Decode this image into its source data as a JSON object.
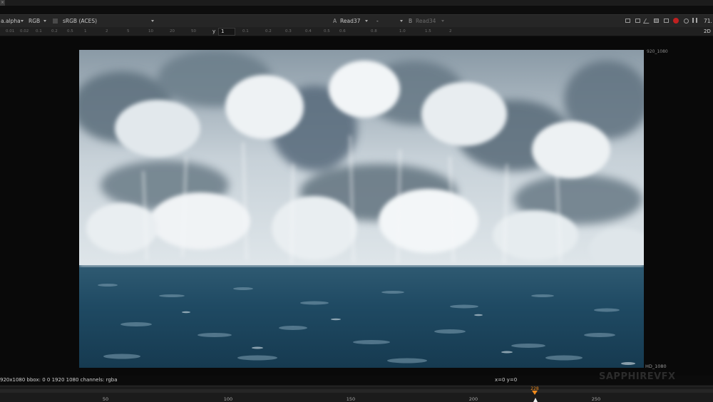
{
  "toolbar": {
    "channel_layer": "a.alpha",
    "channels": "RGB",
    "colorspace": "sRGB (ACES)",
    "input_a_letter": "A",
    "input_a": "Read37",
    "composite_mode": "-",
    "input_b_letter": "B",
    "input_b": "Read34",
    "zoom_readout": "71.",
    "view_mode": "2D"
  },
  "ruler": {
    "y_label": "y",
    "y_value": "1",
    "left_ticks": [
      "0.01",
      "0.02",
      "0.1",
      "0.2",
      "0.5",
      "1",
      "2",
      "5",
      "10",
      "20",
      "50"
    ],
    "right_ticks": [
      "0.1",
      "0.2",
      "0.3",
      "0.4",
      "0.5",
      "0.6",
      "0.8",
      "1.0",
      "1.5",
      "2"
    ]
  },
  "viewer": {
    "format_top_label": "920_1080",
    "format_bottom_label": "HD_1080",
    "image_description_colors": {
      "sky": "#b9c6cf",
      "cloud_shadow": "#5b6e7b",
      "water": "#1f4a63",
      "horizon": "#dfe7ec"
    }
  },
  "info_bar": {
    "info": "920x1080  bbox: 0 0 1920 1080 channels: rgba",
    "coords": "x=0 y=0",
    "watermark": "SAPPHIREVFX"
  },
  "timeline": {
    "current_frame": "228",
    "labels": [
      "50",
      "100",
      "150",
      "200",
      "250"
    ],
    "accent_color": "#f08a1c"
  }
}
